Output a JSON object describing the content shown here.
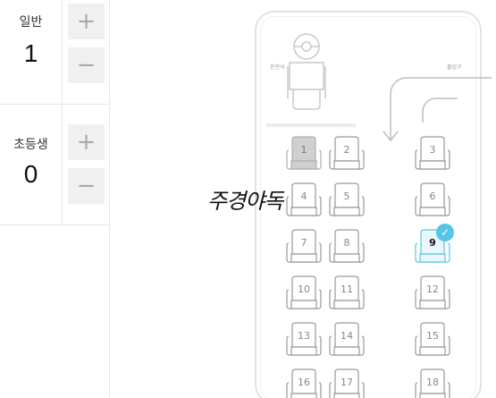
{
  "passengers": {
    "general": {
      "label": "일반",
      "count": "1",
      "plus": "+",
      "minus": "−"
    },
    "elementary": {
      "label": "초등생",
      "count": "0",
      "plus": "+",
      "minus": "−"
    }
  },
  "bus": {
    "driver_label": "운전석",
    "door_label": "출입구",
    "check_mark": "✓",
    "seats": [
      {
        "number": "1",
        "state": "reserved"
      },
      {
        "number": "2",
        "state": "available"
      },
      {
        "number": "3",
        "state": "available"
      },
      {
        "number": "4",
        "state": "available"
      },
      {
        "number": "5",
        "state": "available"
      },
      {
        "number": "6",
        "state": "available"
      },
      {
        "number": "7",
        "state": "available"
      },
      {
        "number": "8",
        "state": "available"
      },
      {
        "number": "9",
        "state": "selected"
      },
      {
        "number": "10",
        "state": "available"
      },
      {
        "number": "11",
        "state": "available"
      },
      {
        "number": "12",
        "state": "available"
      },
      {
        "number": "13",
        "state": "available"
      },
      {
        "number": "14",
        "state": "available"
      },
      {
        "number": "15",
        "state": "available"
      },
      {
        "number": "16",
        "state": "available"
      },
      {
        "number": "17",
        "state": "available"
      },
      {
        "number": "18",
        "state": "available"
      }
    ]
  },
  "watermark": "주경야독",
  "colors": {
    "selected_seat": "#58c5e8",
    "reserved_seat": "#cfcfcf",
    "seat_outline": "#9a9a9a",
    "button_bg": "#f0f0f1"
  }
}
